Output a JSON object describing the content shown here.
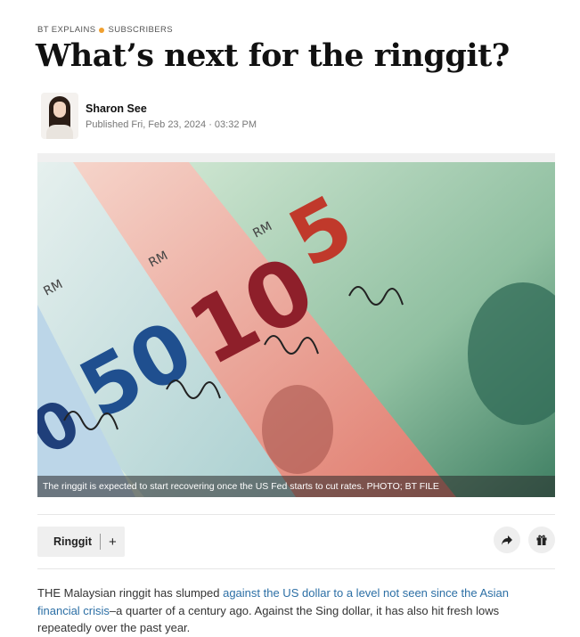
{
  "kicker": {
    "section": "BT EXPLAINS",
    "tier": "SUBSCRIBERS",
    "tier_dot_color": "#f0a030"
  },
  "headline": "What’s next for the ringgit?",
  "author": {
    "name": "Sharon See",
    "published": "Published Fri, Feb 23, 2024 · 03:32 PM"
  },
  "hero": {
    "caption": "The ringgit is expected to start recovering once the US Fed starts to cut rates. PHOTO; BT FILE"
  },
  "tags": {
    "topic": "Ringgit",
    "follow_symbol": "+"
  },
  "actions": {
    "share_icon": "share-arrow-icon",
    "gift_icon": "gift-icon"
  },
  "article": {
    "intro_start": "THE Malaysian ringgit has slumped ",
    "intro_link": "against the US dollar to a level not seen since the Asian financial crisis",
    "intro_end": "–a quarter of a century ago. Against the Sing dollar, it has also hit fresh lows repeatedly over the past year.",
    "link_color": "#2c6fa5"
  }
}
